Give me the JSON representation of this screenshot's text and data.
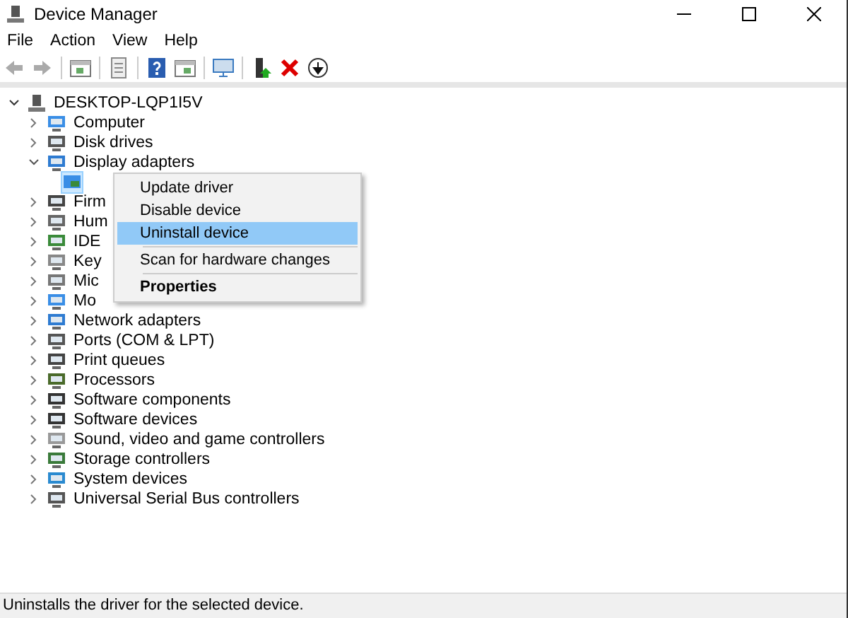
{
  "window": {
    "title": "Device Manager"
  },
  "menu_bar": [
    "File",
    "Action",
    "View",
    "Help"
  ],
  "tree": {
    "label": "DESKTOP-LQP1I5V",
    "expanded": true,
    "children": [
      {
        "label": "Computer",
        "expanded": false
      },
      {
        "label": "Disk drives",
        "expanded": false
      },
      {
        "label": "Display adapters",
        "expanded": true,
        "children": [
          {
            "selected": true
          }
        ]
      },
      {
        "label": "Firm",
        "expanded": false
      },
      {
        "label": "Hum",
        "expanded": false
      },
      {
        "label": "IDE",
        "expanded": false
      },
      {
        "label": "Key",
        "expanded": false
      },
      {
        "label": "Mic",
        "expanded": false
      },
      {
        "label": "Mo",
        "expanded": false
      },
      {
        "label": "Network adapters",
        "expanded": false
      },
      {
        "label": "Ports (COM & LPT)",
        "expanded": false
      },
      {
        "label": "Print queues",
        "expanded": false
      },
      {
        "label": "Processors",
        "expanded": false
      },
      {
        "label": "Software components",
        "expanded": false
      },
      {
        "label": "Software devices",
        "expanded": false
      },
      {
        "label": "Sound, video and game controllers",
        "expanded": false
      },
      {
        "label": "Storage controllers",
        "expanded": false
      },
      {
        "label": "System devices",
        "expanded": false
      },
      {
        "label": "Universal Serial Bus controllers",
        "expanded": false
      }
    ]
  },
  "context_menu": [
    {
      "kind": "item",
      "label": "Update driver",
      "selected": false,
      "default": false
    },
    {
      "kind": "item",
      "label": "Disable device",
      "selected": false,
      "default": false
    },
    {
      "kind": "item",
      "label": "Uninstall device",
      "selected": true,
      "default": false
    },
    {
      "kind": "separator"
    },
    {
      "kind": "item",
      "label": "Scan for hardware changes",
      "selected": false,
      "default": false
    },
    {
      "kind": "separator"
    },
    {
      "kind": "item",
      "label": "Properties",
      "selected": false,
      "default": true
    }
  ],
  "status_bar": "Uninstalls the driver for the selected device."
}
